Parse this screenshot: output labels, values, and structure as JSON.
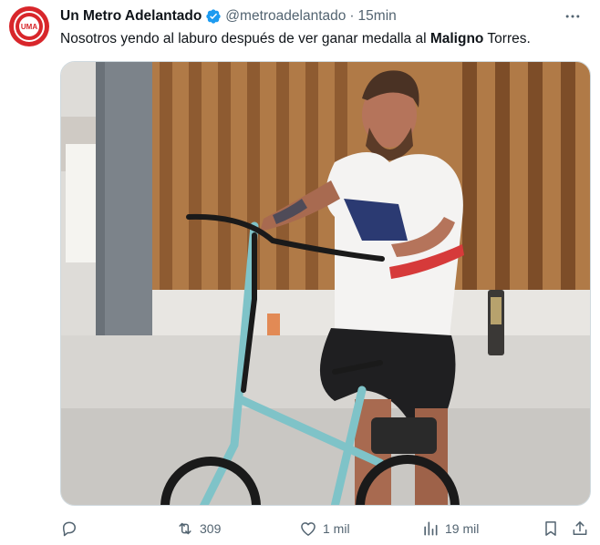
{
  "account": {
    "display_name": "Un Metro Adelantado",
    "handle": "@metroadelantado",
    "separator": "·",
    "time": "15min",
    "avatar_text": "UMA",
    "verified": true,
    "verified_color": "#1d9bf0"
  },
  "tweet": {
    "text_before": "Nosotros yendo al laburo después de ver ganar medalla al ",
    "text_bold": "Maligno",
    "text_after": " Torres."
  },
  "stats": {
    "retweets": "309",
    "likes": "1 mil",
    "views": "19 mil"
  },
  "colors": {
    "text": "#0f1419",
    "secondary": "#536471",
    "avatar_bg": "#d8262b",
    "bike_frame": "#7fc3c8"
  },
  "icons": [
    "more-icon",
    "verified-badge-icon",
    "reply-icon",
    "retweet-icon",
    "like-icon",
    "views-icon",
    "bookmark-icon",
    "share-icon"
  ]
}
